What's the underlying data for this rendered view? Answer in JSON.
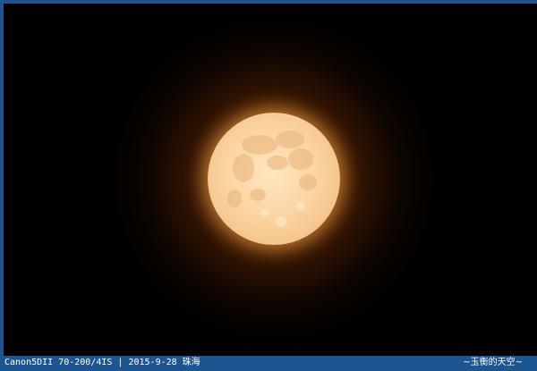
{
  "photo": {
    "subject": "moon-icon",
    "moon_color": "#f9d09c",
    "glow_color": "#e07a1a",
    "background_color": "#000000",
    "frame_color": "#1d5590"
  },
  "caption": {
    "left_text": "Canon5DII 70-200/4IS | 2015-9-28 珠海",
    "right_text": "~玉衡的天空~"
  }
}
